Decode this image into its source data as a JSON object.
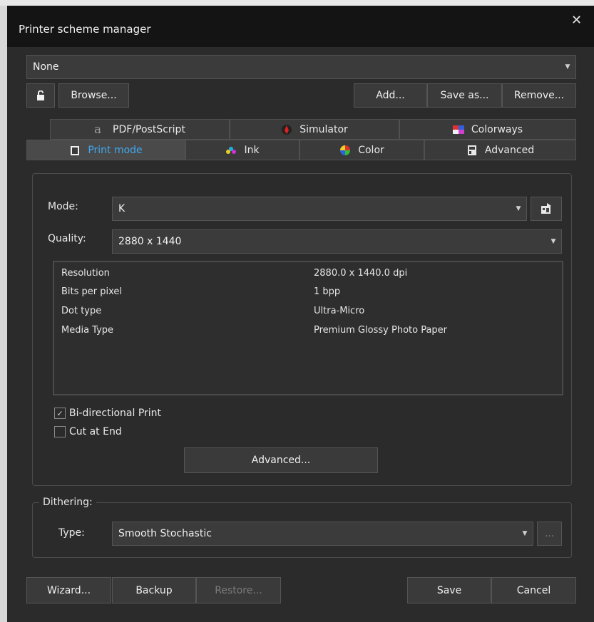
{
  "window": {
    "title": "Printer scheme manager",
    "close_glyph": "✕"
  },
  "scheme": {
    "selected": "None"
  },
  "top_buttons": {
    "browse": "Browse...",
    "add": "Add...",
    "save_as": "Save as...",
    "remove": "Remove..."
  },
  "tabs_row1": [
    {
      "label": "PDF/PostScript",
      "icon": "pdf-icon"
    },
    {
      "label": "Simulator",
      "icon": "simulator-icon"
    },
    {
      "label": "Colorways",
      "icon": "colorways-icon"
    }
  ],
  "tabs_row2": [
    {
      "label": "Print mode",
      "icon": "printer-icon",
      "active": true
    },
    {
      "label": "Ink",
      "icon": "ink-icon"
    },
    {
      "label": "Color",
      "icon": "color-wheel-icon"
    },
    {
      "label": "Advanced",
      "icon": "advanced-icon"
    }
  ],
  "print_mode": {
    "mode_label": "Mode:",
    "mode_value": "K",
    "quality_label": "Quality:",
    "quality_value": "2880 x 1440",
    "info": [
      {
        "key": "Resolution",
        "value": "2880.0 x 1440.0 dpi"
      },
      {
        "key": "Bits per pixel",
        "value": "1 bpp"
      },
      {
        "key": "Dot type",
        "value": "Ultra-Micro"
      },
      {
        "key": "Media Type",
        "value": "Premium Glossy Photo Paper"
      }
    ],
    "bidirectional": {
      "label": "Bi-directional Print",
      "checked": true
    },
    "cut_at_end": {
      "label": "Cut at End",
      "checked": false
    },
    "advanced_button": "Advanced..."
  },
  "dithering": {
    "group_label": "Dithering:",
    "type_label": "Type:",
    "type_value": "Smooth Stochastic",
    "more_button": "..."
  },
  "footer": {
    "wizard": "Wizard...",
    "backup": "Backup",
    "restore": "Restore...",
    "save": "Save",
    "cancel": "Cancel"
  },
  "colors": {
    "accent": "#3fa8f0",
    "background": "#2b2b2b",
    "title_bar": "#141414"
  }
}
